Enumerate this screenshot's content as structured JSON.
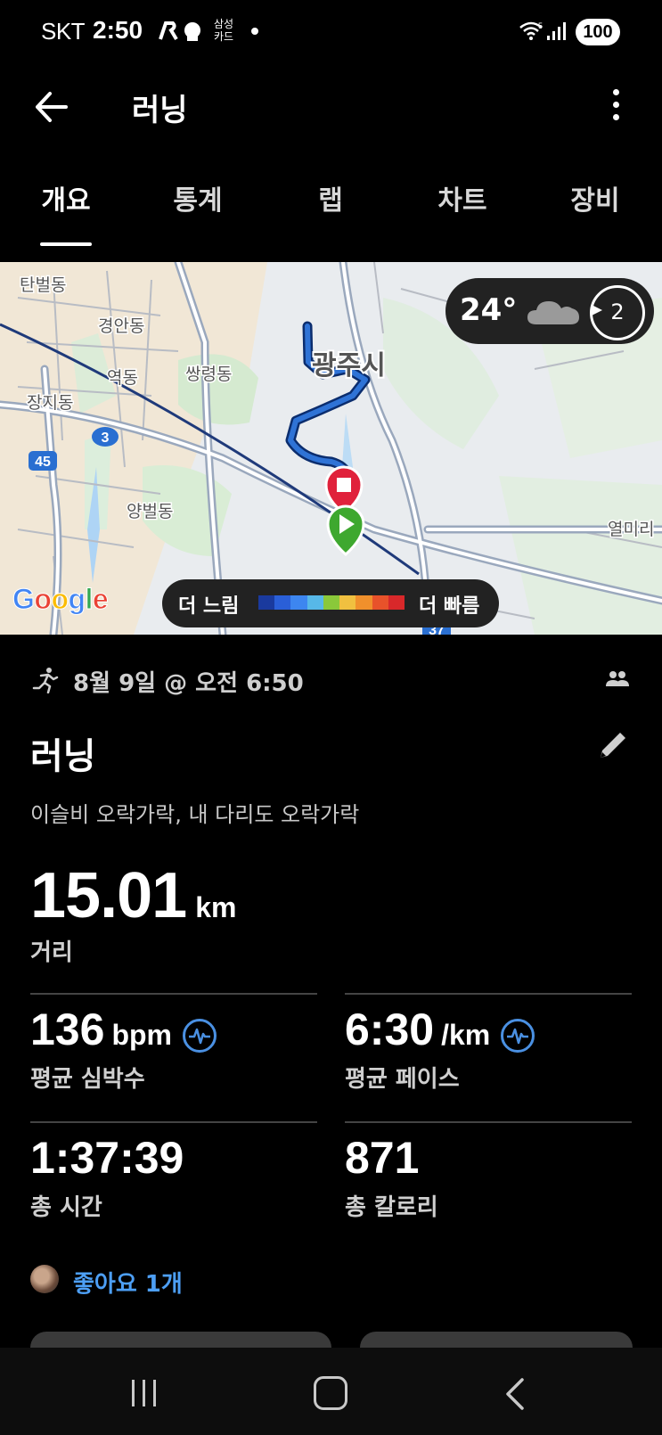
{
  "status_bar": {
    "carrier": "SKT",
    "time": "2:50",
    "card_label": "삼성\n카드",
    "wifi_badge": "5",
    "battery": "100"
  },
  "top_bar": {
    "title": "러닝"
  },
  "tabs": [
    {
      "label": "개요",
      "active": true
    },
    {
      "label": "통계",
      "active": false
    },
    {
      "label": "랩",
      "active": false
    },
    {
      "label": "차트",
      "active": false
    },
    {
      "label": "장비",
      "active": false
    }
  ],
  "map": {
    "place_labels": [
      "탄벌동",
      "경안동",
      "역동",
      "쌍령동",
      "장지동",
      "양벌동",
      "광주시",
      "열미리"
    ],
    "road_badges": [
      "3",
      "45",
      "37"
    ],
    "weather": {
      "temperature": "24°",
      "wind": "2"
    },
    "legend": {
      "slow_label": "더 느림",
      "fast_label": "더 빠름",
      "colors": [
        "#1a3a9e",
        "#2a5fd8",
        "#3d86f0",
        "#57b8e8",
        "#8ac83a",
        "#f0c040",
        "#f0902c",
        "#e8522a",
        "#d8282a"
      ]
    },
    "attribution": "Google"
  },
  "activity": {
    "date": "8월 9일 @ 오전 6:50",
    "title": "러닝",
    "description": "이슬비 오락가락, 내 다리도 오락가락",
    "distance": {
      "value": "15.01",
      "unit": "km",
      "label": "거리"
    },
    "stats": [
      {
        "value": "136",
        "unit": "bpm",
        "label": "평균 심박수",
        "has_hr_icon": true
      },
      {
        "value": "6:30",
        "unit": "/km",
        "label": "평균 페이스",
        "has_hr_icon": true
      },
      {
        "value": "1:37:39",
        "unit": "",
        "label": "총 시간",
        "has_hr_icon": false
      },
      {
        "value": "871",
        "unit": "",
        "label": "총 칼로리",
        "has_hr_icon": false
      }
    ],
    "likes": "좋아요 1개"
  }
}
